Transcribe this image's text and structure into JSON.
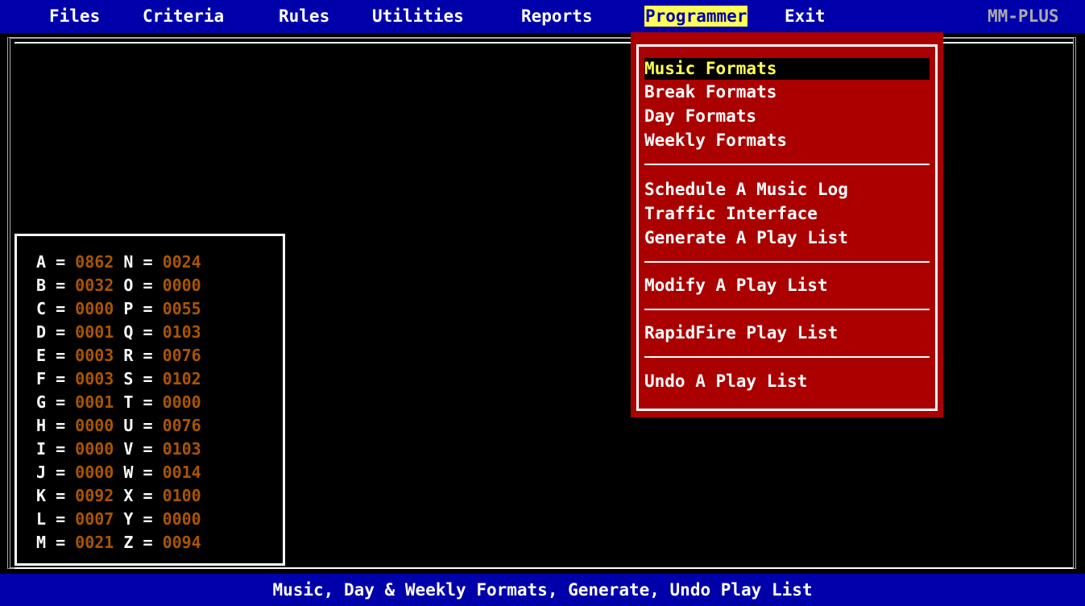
{
  "menubar": {
    "items": [
      "Files",
      "Criteria",
      "Rules",
      "Utilities",
      "Reports",
      "Programmer",
      "Exit"
    ],
    "active": "Programmer",
    "brand": "MM-PLUS"
  },
  "programmer_menu": {
    "items": [
      "Music Formats",
      "Break Formats",
      "Day Formats",
      "Weekly Formats",
      "Schedule A Music Log",
      "Traffic Interface",
      "Generate A Play List",
      "Modify A Play List",
      "RapidFire Play List",
      "Undo A Play List"
    ],
    "highlighted": "Music Formats"
  },
  "letter_counts": {
    "left": [
      {
        "letter": "A",
        "value": "0862"
      },
      {
        "letter": "B",
        "value": "0032"
      },
      {
        "letter": "C",
        "value": "0000"
      },
      {
        "letter": "D",
        "value": "0001"
      },
      {
        "letter": "E",
        "value": "0003"
      },
      {
        "letter": "F",
        "value": "0003"
      },
      {
        "letter": "G",
        "value": "0001"
      },
      {
        "letter": "H",
        "value": "0000"
      },
      {
        "letter": "I",
        "value": "0000"
      },
      {
        "letter": "J",
        "value": "0000"
      },
      {
        "letter": "K",
        "value": "0092"
      },
      {
        "letter": "L",
        "value": "0007"
      },
      {
        "letter": "M",
        "value": "0021"
      }
    ],
    "right": [
      {
        "letter": "N",
        "value": "0024"
      },
      {
        "letter": "O",
        "value": "0000"
      },
      {
        "letter": "P",
        "value": "0055"
      },
      {
        "letter": "Q",
        "value": "0103"
      },
      {
        "letter": "R",
        "value": "0076"
      },
      {
        "letter": "S",
        "value": "0102"
      },
      {
        "letter": "T",
        "value": "0000"
      },
      {
        "letter": "U",
        "value": "0076"
      },
      {
        "letter": "V",
        "value": "0103"
      },
      {
        "letter": "W",
        "value": "0014"
      },
      {
        "letter": "X",
        "value": "0100"
      },
      {
        "letter": "Y",
        "value": "0000"
      },
      {
        "letter": "Z",
        "value": "0094"
      }
    ]
  },
  "status_bar": {
    "text": "Music, Day & Weekly Formats, Generate, Undo Play List"
  },
  "colors": {
    "menubar_bg": "#0000aa",
    "menu_highlight": "#ffff55",
    "dropdown_bg": "#aa0000",
    "count_value": "#aa5500",
    "text": "#ffffff"
  }
}
